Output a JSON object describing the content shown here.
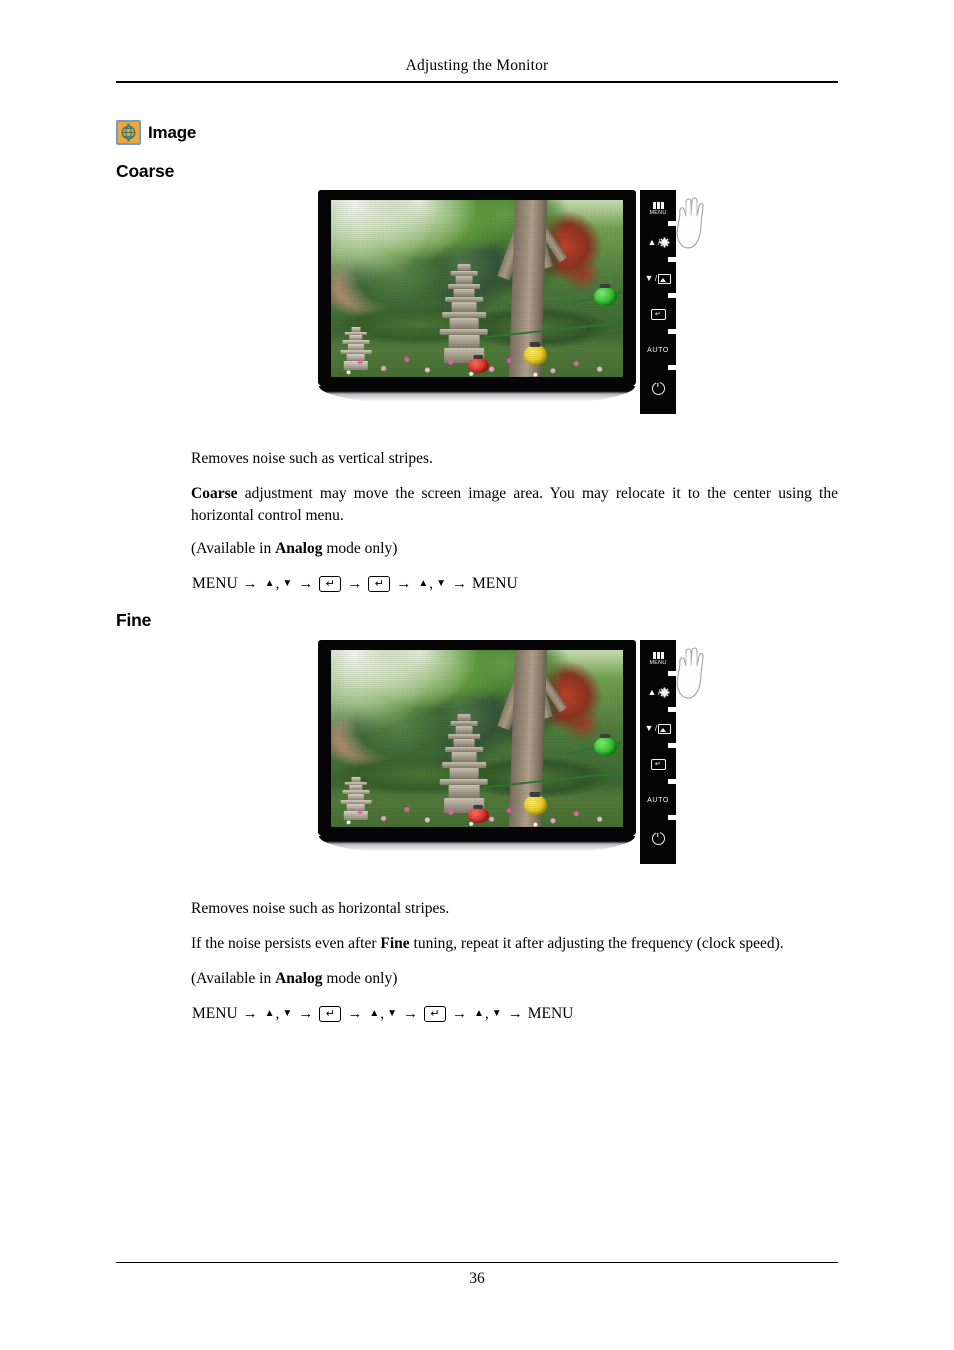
{
  "header": {
    "title": "Adjusting the Monitor"
  },
  "footer": {
    "page_number": "36"
  },
  "section": {
    "icon_name": "image-settings-icon",
    "icon_colors": {
      "fill": "#f0a63c",
      "border": "#6c9fd0",
      "glyph": "#3f7a6d"
    },
    "title": "Image"
  },
  "monitor_controls": {
    "menu_label": "MENU",
    "auto_label": "AUTO",
    "buttons": [
      {
        "name": "menu-button",
        "label": "MENU"
      },
      {
        "name": "up-brightness-button",
        "label": ""
      },
      {
        "name": "down-source-button",
        "label": ""
      },
      {
        "name": "enter-button",
        "label": ""
      },
      {
        "name": "auto-button",
        "label": "AUTO"
      },
      {
        "name": "power-button",
        "label": ""
      }
    ]
  },
  "subsections": [
    {
      "id": "coarse",
      "heading": "Coarse",
      "figure_alt": "Monitor showing a garden photograph with a stone pagoda, with a hand pressing the MENU button",
      "paragraphs": [
        {
          "text": "Removes noise such as vertical stripes.",
          "justify": false
        },
        {
          "text": "Coarse adjustment may move the screen image area. You may relocate it to the center using the horizontal control menu.",
          "bold_prefix": "Coarse",
          "rest": " adjustment may move the screen image area. You may relocate it to the center using the horizontal control menu.",
          "justify": true
        },
        {
          "text": "(Available in Analog mode only)",
          "pre": "(Available in ",
          "bold": "Analog",
          "post": " mode only)",
          "justify": false
        }
      ],
      "nav_sequence": [
        "MENU",
        "→",
        "▲ , ▼",
        "→",
        "ENTER",
        "→",
        "ENTER",
        "→",
        "▲ , ▼",
        "→",
        "MENU"
      ]
    },
    {
      "id": "fine",
      "heading": "Fine",
      "figure_alt": "Monitor showing a garden photograph with a stone pagoda, with a hand pressing the MENU button",
      "paragraphs": [
        {
          "text": "Removes noise such as horizontal stripes.",
          "justify": false
        },
        {
          "text": "If the noise persists even after Fine tuning, repeat it after adjusting the frequency (clock speed).",
          "pre": "If the noise persists even after ",
          "bold": "Fine",
          "post": " tuning, repeat it after adjusting the frequency (clock speed).",
          "justify": false
        },
        {
          "text": "(Available in Analog mode only)",
          "pre": "(Available in ",
          "bold": "Analog",
          "post": " mode only)",
          "justify": false
        }
      ],
      "nav_sequence": [
        "MENU",
        "→",
        "▲ , ▼",
        "→",
        "ENTER",
        "→",
        "▲ , ▼",
        "→",
        "ENTER",
        "→",
        "▲ , ▼",
        "→",
        "MENU"
      ]
    }
  ],
  "text": {
    "coarse_p1": "Removes noise such as vertical stripes.",
    "coarse_p2_bold": "Coarse",
    "coarse_p2_rest": " adjustment may move the screen image area. You may relocate it to the center using the horizontal control menu.",
    "coarse_p3_pre": "(Available in ",
    "coarse_p3_bold": "Analog",
    "coarse_p3_post": " mode only)",
    "fine_p1": "Removes noise such as horizontal stripes.",
    "fine_p2_pre": "If the noise persists even after ",
    "fine_p2_bold": "Fine",
    "fine_p2_post": " tuning, repeat it after adjusting the frequency (clock speed).",
    "fine_p3_pre": "(Available in ",
    "fine_p3_bold": "Analog",
    "fine_p3_post": " mode only)",
    "menu_word": "MENU",
    "arrow": "→",
    "tri_up": "▲",
    "tri_down": "▼",
    "comma": ",",
    "enter_glyph": "↵"
  }
}
